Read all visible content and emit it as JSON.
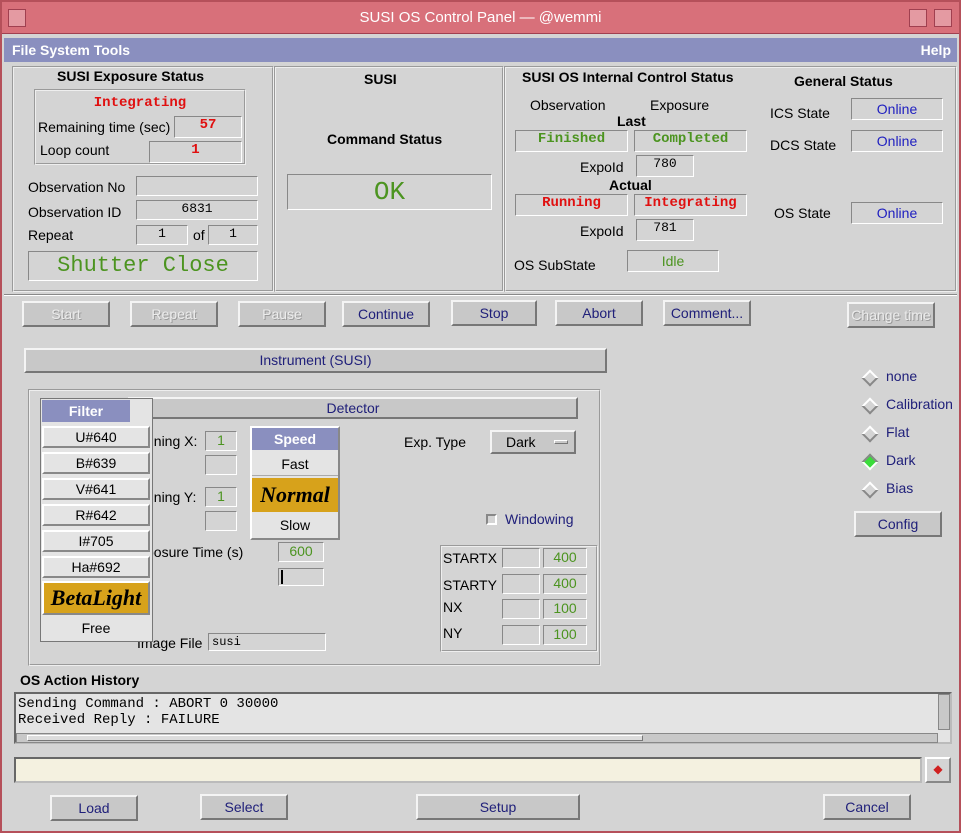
{
  "window": {
    "title": "SUSI OS Control Panel — @wemmi"
  },
  "menu": {
    "file_system_tools": "File System Tools",
    "help": "Help"
  },
  "exposure": {
    "title": "SUSI Exposure Status",
    "state": "Integrating",
    "remaining_label": "Remaining time (sec)",
    "remaining_value": "57",
    "loop_label": "Loop count",
    "loop_value": "1",
    "obs_no_label": "Observation No",
    "obs_no_value": "",
    "obs_id_label": "Observation ID",
    "obs_id_value": "6831",
    "repeat_label": "Repeat",
    "repeat_value": "1",
    "of_label": "of",
    "of_value": "1",
    "shutter": "Shutter Close"
  },
  "susi": {
    "title": "SUSI",
    "cmd_label": "Command Status",
    "cmd_value": "OK"
  },
  "internal": {
    "title": "SUSI OS Internal Control Status",
    "observation_label": "Observation",
    "exposure_label": "Exposure",
    "last_label": "Last",
    "last_obs": "Finished",
    "last_exp": "Completed",
    "expoid_label": "ExpoId",
    "last_expoid": "780",
    "actual_label": "Actual",
    "actual_obs": "Running",
    "actual_exp": "Integrating",
    "actual_expoid": "781",
    "substate_label": "OS SubState",
    "substate_value": "Idle"
  },
  "general": {
    "title": "General Status",
    "ics_label": "ICS State",
    "ics_value": "Online",
    "dcs_label": "DCS State",
    "dcs_value": "Online",
    "os_label": "OS State",
    "os_value": "Online"
  },
  "actions": {
    "start": "Start",
    "repeat": "Repeat",
    "pause": "Pause",
    "continue": "Continue",
    "stop": "Stop",
    "abort": "Abort",
    "comment": "Comment...",
    "change_time": "Change time"
  },
  "instrument": {
    "tab": "Instrument (SUSI)",
    "detector_tab": "Detector"
  },
  "filter": {
    "title": "Filter",
    "items": [
      "U#640",
      "B#639",
      "V#641",
      "R#642",
      "I#705",
      "Ha#692",
      "BetaLight",
      "Free"
    ],
    "selected": "BetaLight"
  },
  "detector": {
    "binx_label": "nning X:",
    "binx_value": "1",
    "biny_label": "nning Y:",
    "biny_value": "1",
    "speed_title": "Speed",
    "speed_fast": "Fast",
    "speed_normal": "Normal",
    "speed_slow": "Slow",
    "exptype_label": "Exp. Type",
    "exptype_value": "Dark",
    "windowing_label": "Windowing",
    "exptime_label": "posure Time (s)",
    "exptime_value": "600",
    "imagefile_label": "Image File",
    "imagefile_value": "susi",
    "startx_label": "STARTX",
    "startx_value": "400",
    "starty_label": "STARTY",
    "starty_value": "400",
    "nx_label": "NX",
    "nx_value": "100",
    "ny_label": "NY",
    "ny_value": "100"
  },
  "exposure_type": {
    "options": [
      "none",
      "Calibration",
      "Flat",
      "Dark",
      "Bias"
    ],
    "selected": "Dark",
    "config": "Config"
  },
  "history": {
    "title": "OS Action History",
    "lines": [
      "Sending Command : ABORT 0 30000",
      "Received Reply : FAILURE"
    ]
  },
  "bottom": {
    "load": "Load",
    "select": "Select",
    "setup": "Setup",
    "cancel": "Cancel"
  }
}
